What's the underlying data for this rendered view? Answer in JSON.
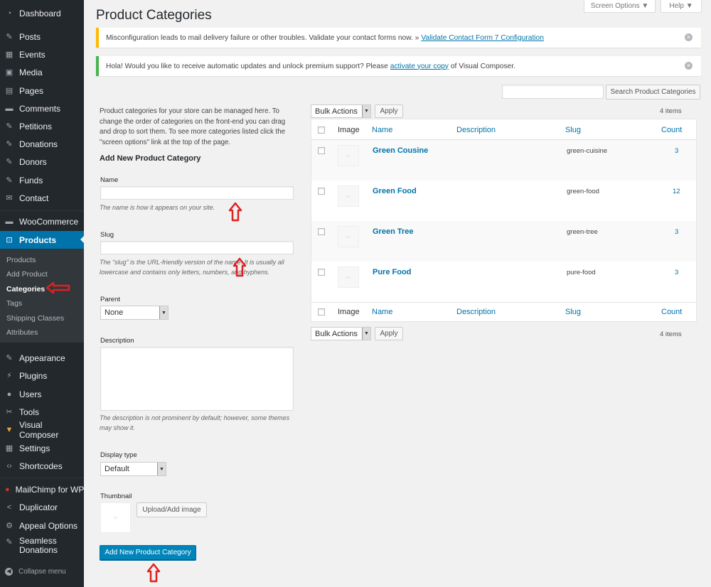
{
  "sidebar": {
    "top": [
      {
        "label": "Dashboard",
        "icon": "dashboard-icon",
        "glyph": "◔"
      },
      {
        "label": "Posts",
        "icon": "pin-icon",
        "glyph": "✎"
      },
      {
        "label": "Events",
        "icon": "calendar-icon",
        "glyph": "▦"
      },
      {
        "label": "Media",
        "icon": "media-icon",
        "glyph": "▣"
      },
      {
        "label": "Pages",
        "icon": "pages-icon",
        "glyph": "▤"
      },
      {
        "label": "Comments",
        "icon": "comment-icon",
        "glyph": "▬"
      },
      {
        "label": "Petitions",
        "icon": "edit-icon",
        "glyph": "✎"
      },
      {
        "label": "Donations",
        "icon": "pin-icon",
        "glyph": "✎"
      },
      {
        "label": "Donors",
        "icon": "pin-icon",
        "glyph": "✎"
      },
      {
        "label": "Funds",
        "icon": "pin-icon",
        "glyph": "✎"
      },
      {
        "label": "Contact",
        "icon": "mail-icon",
        "glyph": "✉"
      }
    ],
    "woo": [
      {
        "label": "WooCommerce",
        "icon": "woocommerce-icon",
        "glyph": "▬"
      },
      {
        "label": "Products",
        "icon": "cart-icon",
        "glyph": "⊡"
      }
    ],
    "submenu": [
      "Products",
      "Add Product",
      "Categories",
      "Tags",
      "Shipping Classes",
      "Attributes"
    ],
    "bottom": [
      {
        "label": "Appearance",
        "icon": "brush-icon",
        "glyph": "✎"
      },
      {
        "label": "Plugins",
        "icon": "plugin-icon",
        "glyph": "⚡"
      },
      {
        "label": "Users",
        "icon": "users-icon",
        "glyph": "●"
      },
      {
        "label": "Tools",
        "icon": "wrench-icon",
        "glyph": "✂"
      },
      {
        "label": "Visual Composer",
        "icon": "visual-composer-icon",
        "glyph": "▼"
      },
      {
        "label": "Settings",
        "icon": "settings-icon",
        "glyph": "▦"
      },
      {
        "label": "Shortcodes",
        "icon": "code-icon",
        "glyph": "‹›"
      },
      {
        "label": "MailChimp for WP",
        "icon": "mailchimp-icon",
        "glyph": "●"
      },
      {
        "label": "Duplicator",
        "icon": "share-icon",
        "glyph": "<"
      },
      {
        "label": "Appeal Options",
        "icon": "gear-icon",
        "glyph": "⚙"
      },
      {
        "label": "Seamless Donations",
        "icon": "pin-icon",
        "glyph": "✎"
      }
    ],
    "collapse": "Collapse menu"
  },
  "header": {
    "title": "Product Categories",
    "screen_options": "Screen Options ▼",
    "help": "Help ▼"
  },
  "notices": [
    {
      "text": "Misconfiguration leads to mail delivery failure or other troubles. Validate your contact forms now. »",
      "link": "Validate Contact Form 7 Configuration",
      "after": ""
    },
    {
      "text": "Hola! Would you like to receive automatic updates and unlock premium support? Please",
      "link": "activate your copy",
      "after": "of Visual Composer."
    }
  ],
  "search": {
    "value": "",
    "button": "Search Product Categories"
  },
  "form": {
    "intro": "Product categories for your store can be managed here. To change the order of categories on the front-end you can drag and drop to sort them. To see more categories listed click the \"screen options\" link at the top of the page.",
    "heading": "Add New Product Category",
    "name_label": "Name",
    "name_value": "",
    "name_help": "The name is how it appears on your site.",
    "slug_label": "Slug",
    "slug_value": "",
    "slug_help": "The “slug” is the URL-friendly version of the name. It is usually all lowercase and contains only letters, numbers, and hyphens.",
    "parent_label": "Parent",
    "parent_value": "None",
    "desc_label": "Description",
    "desc_value": "",
    "desc_help": "The description is not prominent by default; however, some themes may show it.",
    "display_label": "Display type",
    "display_value": "Default",
    "thumb_label": "Thumbnail",
    "upload_button": "Upload/Add image",
    "submit": "Add New Product Category"
  },
  "bulk": {
    "label": "Bulk Actions",
    "apply": "Apply",
    "count": "4 items"
  },
  "table": {
    "columns": [
      "Image",
      "Name",
      "Description",
      "Slug",
      "Count"
    ],
    "rows": [
      {
        "name": "Green Cousine",
        "slug": "green-cuisine",
        "count": "3"
      },
      {
        "name": "Green Food",
        "slug": "green-food",
        "count": "12"
      },
      {
        "name": "Green Tree",
        "slug": "green-tree",
        "count": "3"
      },
      {
        "name": "Pure Food",
        "slug": "pure-food",
        "count": "3"
      }
    ]
  },
  "colors": {
    "sidebar": "#23282d",
    "accent": "#0073aa",
    "annotation": "#e02020",
    "notice_warning": "#ffb900",
    "notice_success": "#46b450"
  }
}
